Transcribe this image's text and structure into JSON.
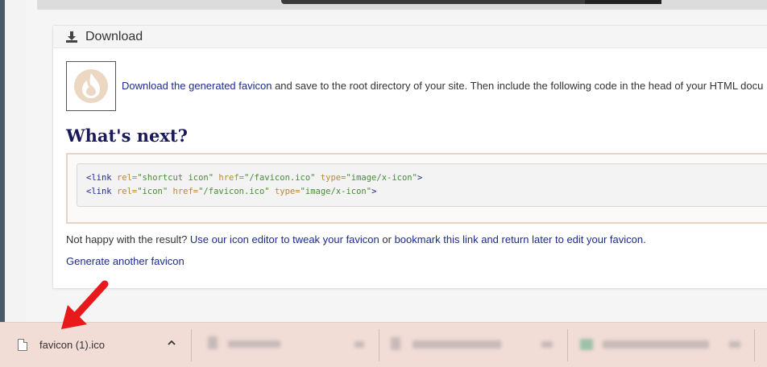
{
  "panel": {
    "header_title": "Download",
    "download_link": "Download the generated favicon",
    "download_rest": " and save to the root directory of your site. Then include the following code in the head of your HTML docu",
    "whats_next": "What's next?",
    "code_line1": {
      "open": "<link ",
      "attr1": "rel=",
      "val1": "\"shortcut icon\"",
      "attr2": " href=",
      "val2": "\"/favicon.ico\"",
      "attr3": " type=",
      "val3": "\"image/x-icon\"",
      "close": ">"
    },
    "code_line2": {
      "open": "<link ",
      "attr1": "rel=",
      "val1": "\"icon\"",
      "attr2": " href=",
      "val2": "\"/favicon.ico\"",
      "attr3": " type=",
      "val3": "\"image/x-icon\"",
      "close": ">"
    },
    "unhappy_prefix": "Not happy with the result? ",
    "icon_editor_link": "Use our icon editor to tweak your favicon",
    "or_text": " or ",
    "bookmark_link": "bookmark this link and return later to edit your favicon",
    "period": ".",
    "generate_link": "Generate another favicon"
  },
  "download_bar": {
    "item1_name": "favicon (1).ico",
    "chevron": "^"
  },
  "colors": {
    "link": "#1c2b8c",
    "heading": "#1a1a5a",
    "download_bar_bg": "#f1dcd6",
    "arrow": "#e8191a"
  }
}
